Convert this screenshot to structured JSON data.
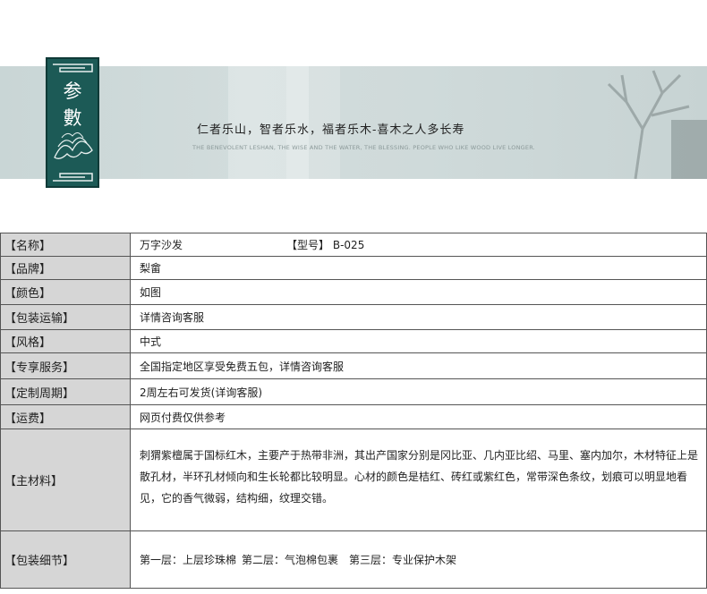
{
  "banner": {
    "badge_top": "参",
    "badge_bottom": "數",
    "slogan_cn": "仁者乐山，智者乐水，福者乐木-喜木之人多长寿",
    "slogan_en": "THE BENEVOLENT LESHAN, THE WISE AND THE WATER, THE BLESSING. PEOPLE WHO LIKE WOOD LIVE LONGER."
  },
  "specs": {
    "name": {
      "label": "【名称】",
      "value": "万字沙发",
      "model_label": "【型号】",
      "model_value": "B-025"
    },
    "brand": {
      "label": "【品牌】",
      "value": "梨畲"
    },
    "color": {
      "label": "【颜色】",
      "value": "如图"
    },
    "shipping": {
      "label": "【包装运输】",
      "value": "详情咨询客服"
    },
    "style": {
      "label": "【风格】",
      "value": "中式"
    },
    "service": {
      "label": "【专享服务】",
      "value": "全国指定地区享受免费五包，详情咨询客服"
    },
    "custom": {
      "label": "【定制周期】",
      "value": "2周左右可发货(详询客服)"
    },
    "freight": {
      "label": "【运费】",
      "value": "网页付费仅供参考"
    },
    "material": {
      "label": "【主材料】",
      "value": "刺猬紫檀属于国标红木，主要产于热带非洲，其出产国家分别是冈比亚、几内亚比绍、马里、塞内加尔，木材特征上是散孔材，半环孔材倾向和生长轮都比较明显。心材的颜色是桔红、砖红或紫红色，常带深色条纹，划痕可以明显地看见，它的香气微弱，结构细，纹理交错。"
    },
    "packing": {
      "label": "【包装细节】",
      "layer1": "第一层：上层珍珠棉",
      "layer2": "第二层：气泡棉包裹",
      "layer3": "第三层：专业保护木架"
    }
  }
}
